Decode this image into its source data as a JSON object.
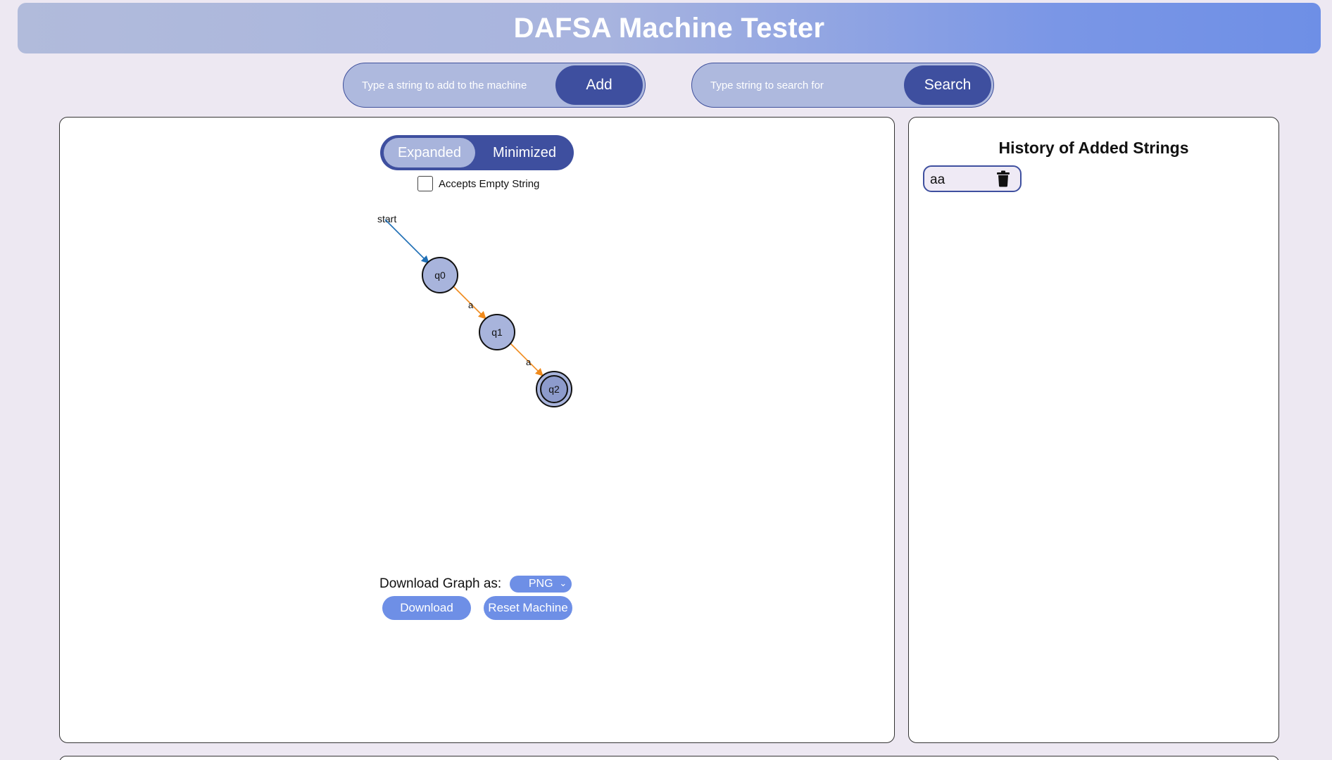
{
  "header": {
    "title": "DAFSA Machine Tester"
  },
  "add_form": {
    "placeholder": "Type a string to add to the machine",
    "button_label": "Add"
  },
  "search_form": {
    "placeholder": "Type string to search for",
    "button_label": "Search"
  },
  "view_toggle": {
    "options": [
      "Expanded",
      "Minimized"
    ],
    "selected": "Expanded"
  },
  "empty_string_checkbox": {
    "label": "Accepts Empty String",
    "checked": false
  },
  "graph": {
    "start_label": "start",
    "states": [
      {
        "id": "q0",
        "accepting": false
      },
      {
        "id": "q1",
        "accepting": false
      },
      {
        "id": "q2",
        "accepting": true
      }
    ],
    "transitions": [
      {
        "from": "q0",
        "to": "q1",
        "symbol": "a"
      },
      {
        "from": "q1",
        "to": "q2",
        "symbol": "a"
      }
    ],
    "colors": {
      "state_fill": "#a8b4dc",
      "accepting_fill": "#8d9bcc",
      "start_edge": "#1f6fb5",
      "transition_edge": "#f08a1c"
    }
  },
  "download": {
    "label": "Download Graph as:",
    "format": "PNG",
    "download_button": "Download",
    "reset_button": "Reset Machine"
  },
  "history": {
    "title": "History of Added Strings",
    "items": [
      {
        "text": "aa"
      }
    ]
  }
}
